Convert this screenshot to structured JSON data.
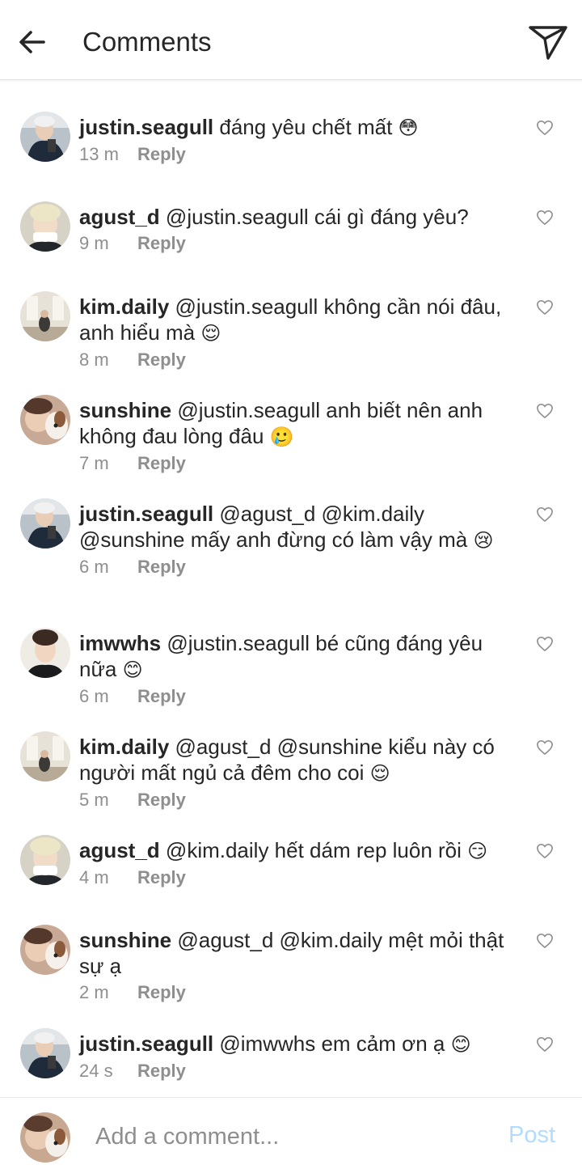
{
  "header": {
    "title": "Comments",
    "back_icon": "arrow-left-icon",
    "send_icon": "paper-plane-icon"
  },
  "comments": [
    {
      "user": "justin.seagull",
      "text": "đáng yêu chết mất",
      "emoji": "😳",
      "time": "13 m",
      "reply": "Reply",
      "avatar": "justin"
    },
    {
      "user": "agust_d",
      "text": "@justin.seagull cái gì đáng yêu?",
      "emoji": "",
      "time": "9 m",
      "reply": "Reply",
      "avatar": "agust"
    },
    {
      "user": "kim.daily",
      "text": "@justin.seagull không cần nói đâu, anh hiểu mà",
      "emoji": "😌",
      "time": "8 m",
      "reply": "Reply",
      "avatar": "kim"
    },
    {
      "user": "sunshine",
      "text": "@justin.seagull anh biết nên anh không đau lòng đâu",
      "emoji": "🥲",
      "time": "7 m",
      "reply": "Reply",
      "avatar": "sunshine"
    },
    {
      "user": "justin.seagull",
      "text": "@agust_d @kim.daily @sunshine mấy anh đừng có làm vậy mà",
      "emoji": "😢",
      "time": "6 m",
      "reply": "Reply",
      "avatar": "justin"
    },
    {
      "user": "imwwhs",
      "text": "@justin.seagull bé cũng đáng yêu nữa",
      "emoji": "😊",
      "time": "6 m",
      "reply": "Reply",
      "avatar": "imwwhs"
    },
    {
      "user": "kim.daily",
      "text": "@agust_d @sunshine kiểu này có người mất ngủ cả đêm cho coi",
      "emoji": "😌",
      "time": "5 m",
      "reply": "Reply",
      "avatar": "kim"
    },
    {
      "user": "agust_d",
      "text": "@kim.daily hết dám rep luôn rồi",
      "emoji": "😏",
      "time": "4 m",
      "reply": "Reply",
      "avatar": "agust"
    },
    {
      "user": "sunshine",
      "text": "@agust_d @kim.daily mệt mỏi thật sự ạ",
      "emoji": "",
      "time": "2 m",
      "reply": "Reply",
      "avatar": "sunshine"
    },
    {
      "user": "justin.seagull",
      "text": "@imwwhs em cảm ơn ạ",
      "emoji": "😊",
      "time": "24 s",
      "reply": "Reply",
      "avatar": "justin"
    }
  ],
  "composer": {
    "placeholder": "Add a comment...",
    "post_label": "Post"
  },
  "colors": {
    "text": "#262626",
    "muted": "#8e8e8e",
    "post_disabled": "#b3dbff"
  }
}
